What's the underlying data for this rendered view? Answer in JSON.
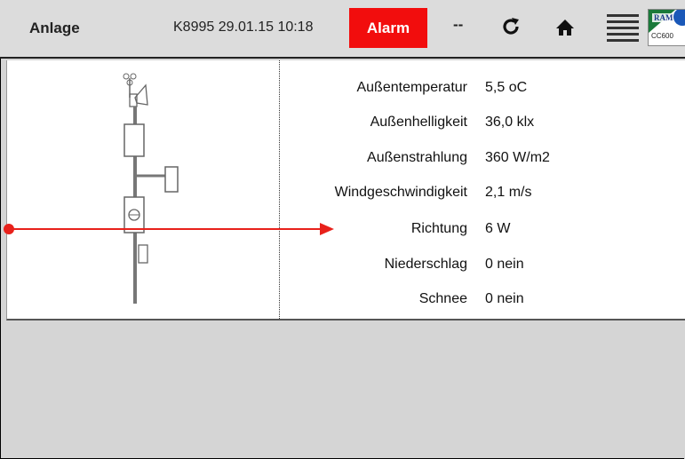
{
  "header": {
    "title": "Anlage",
    "info": "K8995 29.01.15 10:18",
    "alarm_label": "Alarm",
    "dash": "--",
    "logo_text": "CC600",
    "logo_brand": "RAM",
    "icons": [
      "refresh-icon",
      "home-icon",
      "menu-icon",
      "logo-icon"
    ],
    "alarm_color": "#f20d0d"
  },
  "sensors": [
    {
      "label": "Außentemperatur",
      "value": "5,5 oC"
    },
    {
      "label": "Außenhelligkeit",
      "value": "36,0 klx"
    },
    {
      "label": "Außenstrahlung",
      "value": "360 W/m2"
    },
    {
      "label": "Windgeschwindigkeit",
      "value": "2,1 m/s"
    },
    {
      "label": "Richtung",
      "value": "6 W"
    },
    {
      "label": "Niederschlag",
      "value": "0 nein"
    },
    {
      "label": "Schnee",
      "value": "0 nein"
    }
  ],
  "annotation_color": "#e8211b"
}
